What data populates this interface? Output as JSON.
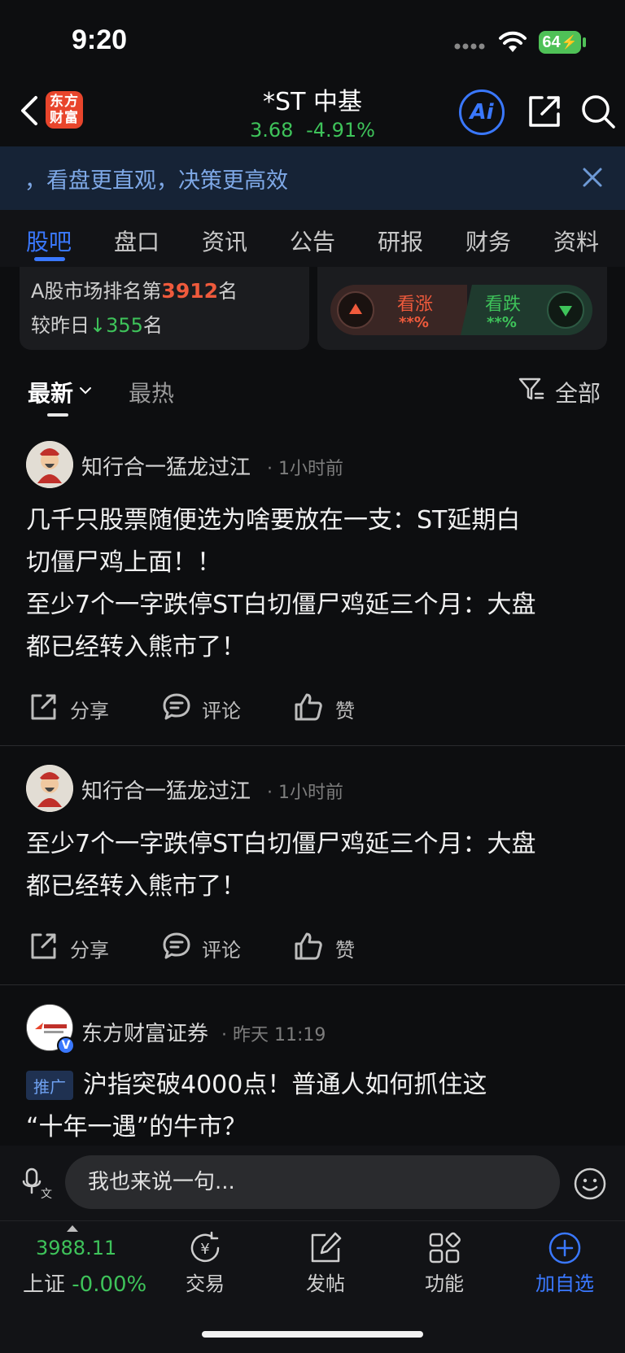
{
  "status_bar": {
    "time": "9:20",
    "battery": "64"
  },
  "header": {
    "logo_text_1": "东方",
    "logo_text_2": "财富",
    "stock_name": "*ST 中基",
    "price": "3.68",
    "change_pct": "-4.91%",
    "ai_label": "Ai"
  },
  "banner": {
    "text": "，看盘更直观，决策更高效"
  },
  "tabs": [
    "股吧",
    "盘口",
    "资讯",
    "公告",
    "研报",
    "财务",
    "资料"
  ],
  "rank": {
    "line1_prefix": "A股市场排名第",
    "rank_value": "3912",
    "line1_suffix": "名",
    "line2_prefix": "较昨日",
    "down_arrow": "↓",
    "change_value": "355",
    "line2_suffix": "名"
  },
  "vote": {
    "up_label": "看涨",
    "up_pct": "**%",
    "down_label": "看跌",
    "down_pct": "**%"
  },
  "sort": {
    "latest": "最新",
    "hot": "最热",
    "filter": "全部"
  },
  "posts": [
    {
      "author": "知行合一猛龙过江",
      "time": "· 1小时前",
      "text_lines": [
        "几千只股票随便选为啥要放在一支：ST延期白",
        "切僵尸鸡上面！！",
        "至少7个一字跌停ST白切僵尸鸡延三个月：大盘",
        "都已经转入熊市了！"
      ],
      "actions": {
        "share": "分享",
        "comment": "评论",
        "like": "赞"
      }
    },
    {
      "author": "知行合一猛龙过江",
      "time": "· 1小时前",
      "text_lines": [
        "至少7个一字跌停ST白切僵尸鸡延三个月：大盘",
        "都已经转入熊市了！"
      ],
      "actions": {
        "share": "分享",
        "comment": "评论",
        "like": "赞"
      }
    },
    {
      "author": "东方财富证券",
      "time": "· 昨天 11:19",
      "tag": "推广",
      "text_lines": [
        "沪指突破4000点！普通人如何抓住这",
        "“十年一遇”的牛市？"
      ],
      "verified": "V"
    }
  ],
  "comment": {
    "placeholder": "我也来说一句..."
  },
  "bottom_nav": {
    "index_value": "3988.11",
    "index_name": "上证",
    "index_change": "-0.00%",
    "trade": "交易",
    "trade_icon_glyph": "¥",
    "post": "发帖",
    "functions": "功能",
    "add_watch": "加自选"
  },
  "colors": {
    "accent_blue": "#3a78ff",
    "up_red": "#ef5a3c",
    "down_green": "#3ec35a",
    "background": "#0d0e10"
  }
}
